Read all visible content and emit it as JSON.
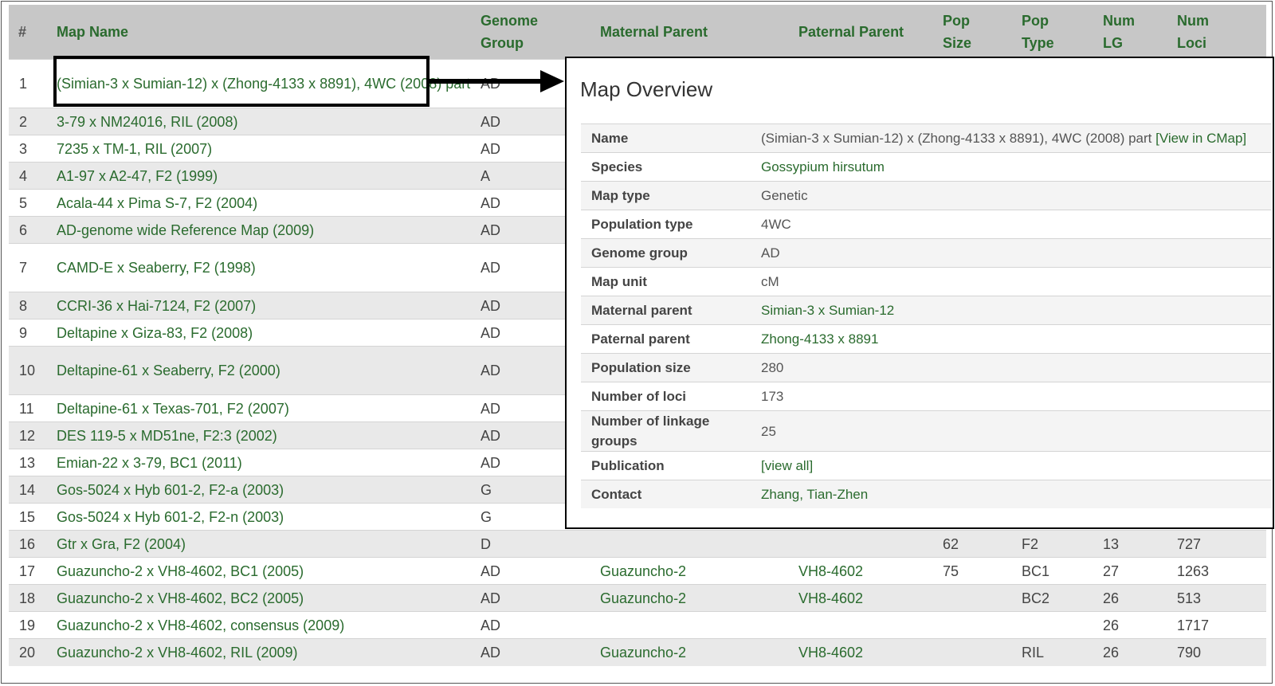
{
  "columns": {
    "num": "#",
    "name": "Map Name",
    "genome_l1": "Genome",
    "genome_l2": "Group",
    "maternal": "Maternal Parent",
    "paternal": "Paternal Parent",
    "pop_size_l1": "Pop",
    "pop_size_l2": "Size",
    "pop_type_l1": "Pop",
    "pop_type_l2": "Type",
    "num_lg_l1": "Num",
    "num_lg_l2": "LG",
    "num_loci_l1": "Num",
    "num_loci_l2": "Loci"
  },
  "rows": [
    {
      "idx": "1",
      "name": "(Simian-3 x Sumian-12) x (Zhong-4133 x 8891), 4WC (2008) part",
      "genome": "AD",
      "maternal": "",
      "paternal": "",
      "pop_size": "",
      "pop_type": "",
      "num_lg": "",
      "num_loci": ""
    },
    {
      "idx": "2",
      "name": "3-79 x NM24016, RIL (2008)",
      "genome": "AD",
      "maternal": "",
      "paternal": "",
      "pop_size": "",
      "pop_type": "",
      "num_lg": "",
      "num_loci": ""
    },
    {
      "idx": "3",
      "name": "7235 x TM-1, RIL (2007)",
      "genome": "AD",
      "maternal": "",
      "paternal": "",
      "pop_size": "",
      "pop_type": "",
      "num_lg": "",
      "num_loci": ""
    },
    {
      "idx": "4",
      "name": "A1-97 x A2-47, F2 (1999)",
      "genome": "A",
      "maternal": "",
      "paternal": "",
      "pop_size": "",
      "pop_type": "",
      "num_lg": "",
      "num_loci": ""
    },
    {
      "idx": "5",
      "name": "Acala-44 x Pima S-7, F2 (2004)",
      "genome": "AD",
      "maternal": "",
      "paternal": "",
      "pop_size": "",
      "pop_type": "",
      "num_lg": "",
      "num_loci": ""
    },
    {
      "idx": "6",
      "name": "AD-genome wide Reference Map (2009)",
      "genome": "AD",
      "maternal": "",
      "paternal": "",
      "pop_size": "",
      "pop_type": "",
      "num_lg": "",
      "num_loci": ""
    },
    {
      "idx": "7",
      "name": "CAMD-E x Seaberry, F2 (1998)",
      "genome": "AD",
      "maternal": "",
      "paternal": "",
      "pop_size": "",
      "pop_type": "",
      "num_lg": "",
      "num_loci": ""
    },
    {
      "idx": "8",
      "name": "CCRI-36 x Hai-7124, F2 (2007)",
      "genome": "AD",
      "maternal": "",
      "paternal": "",
      "pop_size": "",
      "pop_type": "",
      "num_lg": "",
      "num_loci": ""
    },
    {
      "idx": "9",
      "name": "Deltapine x Giza-83, F2 (2008)",
      "genome": "AD",
      "maternal": "",
      "paternal": "",
      "pop_size": "",
      "pop_type": "",
      "num_lg": "",
      "num_loci": ""
    },
    {
      "idx": "10",
      "name": "Deltapine-61 x Seaberry, F2 (2000)",
      "genome": "AD",
      "maternal": "",
      "paternal": "",
      "pop_size": "",
      "pop_type": "",
      "num_lg": "",
      "num_loci": ""
    },
    {
      "idx": "11",
      "name": "Deltapine-61 x Texas-701, F2 (2007)",
      "genome": "AD",
      "maternal": "",
      "paternal": "",
      "pop_size": "",
      "pop_type": "",
      "num_lg": "",
      "num_loci": ""
    },
    {
      "idx": "12",
      "name": "DES 119-5 x MD51ne, F2:3 (2002)",
      "genome": "AD",
      "maternal": "",
      "paternal": "",
      "pop_size": "",
      "pop_type": "",
      "num_lg": "",
      "num_loci": ""
    },
    {
      "idx": "13",
      "name": "Emian-22 x 3-79, BC1 (2011)",
      "genome": "AD",
      "maternal": "",
      "paternal": "",
      "pop_size": "",
      "pop_type": "",
      "num_lg": "",
      "num_loci": ""
    },
    {
      "idx": "14",
      "name": "Gos-5024 x Hyb 601-2, F2-a (2003)",
      "genome": "G",
      "maternal": "",
      "paternal": "",
      "pop_size": "",
      "pop_type": "",
      "num_lg": "",
      "num_loci": ""
    },
    {
      "idx": "15",
      "name": "Gos-5024 x Hyb 601-2, F2-n (2003)",
      "genome": "G",
      "maternal": "",
      "paternal": "",
      "pop_size": "",
      "pop_type": "",
      "num_lg": "",
      "num_loci": ""
    },
    {
      "idx": "16",
      "name": "Gtr x Gra, F2 (2004)",
      "genome": "D",
      "maternal": "",
      "paternal": "",
      "pop_size": "62",
      "pop_type": "F2",
      "num_lg": "13",
      "num_loci": "727"
    },
    {
      "idx": "17",
      "name": "Guazuncho-2 x VH8-4602, BC1 (2005)",
      "genome": "AD",
      "maternal": "Guazuncho-2",
      "paternal": "VH8-4602",
      "pop_size": "75",
      "pop_type": "BC1",
      "num_lg": "27",
      "num_loci": "1263"
    },
    {
      "idx": "18",
      "name": "Guazuncho-2 x VH8-4602, BC2 (2005)",
      "genome": "AD",
      "maternal": "Guazuncho-2",
      "paternal": "VH8-4602",
      "pop_size": "",
      "pop_type": "BC2",
      "num_lg": "26",
      "num_loci": "513"
    },
    {
      "idx": "19",
      "name": "Guazuncho-2 x VH8-4602, consensus (2009)",
      "genome": "AD",
      "maternal": "",
      "paternal": "",
      "pop_size": "",
      "pop_type": "",
      "num_lg": "26",
      "num_loci": "1717"
    },
    {
      "idx": "20",
      "name": "Guazuncho-2 x VH8-4602, RIL (2009)",
      "genome": "AD",
      "maternal": "Guazuncho-2",
      "paternal": "VH8-4602",
      "pop_size": "",
      "pop_type": "RIL",
      "num_lg": "26",
      "num_loci": "790"
    }
  ],
  "overview": {
    "title": "Map Overview",
    "name_label": "Name",
    "name_value": "(Simian-3 x Sumian-12) x (Zhong-4133 x 8891), 4WC (2008) part",
    "name_link": "[View in CMap]",
    "species_label": "Species",
    "species_value": "Gossypium hirsutum",
    "map_type_label": "Map type",
    "map_type_value": "Genetic",
    "pop_type_label": "Population type",
    "pop_type_value": "4WC",
    "genome_label": "Genome group",
    "genome_value": "AD",
    "unit_label": "Map unit",
    "unit_value": "cM",
    "maternal_label": "Maternal parent",
    "maternal_value": "Simian-3 x Sumian-12",
    "paternal_label": "Paternal parent",
    "paternal_value": "Zhong-4133 x 8891",
    "pop_size_label": "Population size",
    "pop_size_value": "280",
    "loci_label": "Number of loci",
    "loci_value": "173",
    "lg_label": "Number of linkage groups",
    "lg_value": "25",
    "publication_label": "Publication",
    "publication_value": "[view all]",
    "contact_label": "Contact",
    "contact_value": "Zhang, Tian-Zhen"
  }
}
